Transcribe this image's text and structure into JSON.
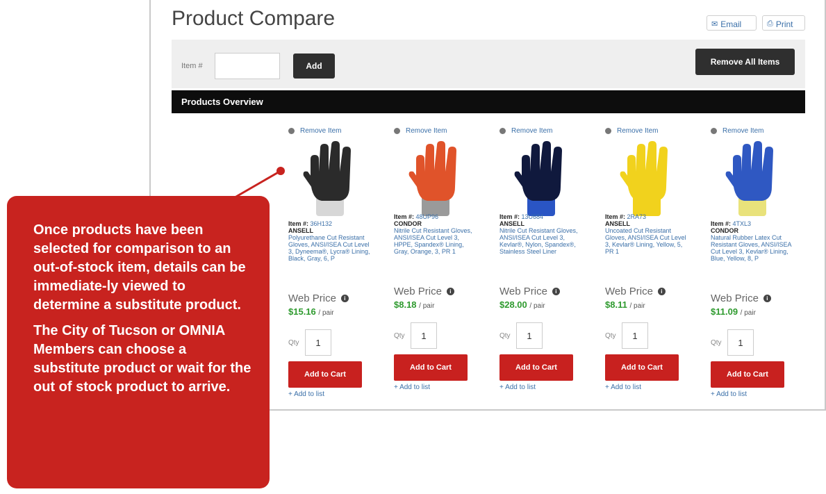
{
  "page": {
    "title": "Product Compare",
    "email_label": "Email",
    "print_label": "Print",
    "item_label": "Item #",
    "item_value": "",
    "add_label": "Add",
    "remove_all_label": "Remove All Items",
    "overview_label": "Products Overview"
  },
  "icons": {
    "email": "envelope-icon",
    "print": "printer-icon",
    "remove": "remove-circle-icon",
    "info": "info-circle-icon"
  },
  "colors": {
    "accent_red": "#c8211f",
    "price_green": "#2e9a2e",
    "link_blue": "#3a6fa8",
    "dark_button": "#2f2f2f"
  },
  "products": [
    {
      "remove_label": "Remove Item",
      "item_prefix": "Item #:",
      "item_no": "36H132",
      "brand": "ANSELL",
      "description": "Polyurethane Cut Resistant Gloves, ANSI/ISEA Cut Level 3, Dyneema®, Lycra® Lining, Black, Gray, 6, P",
      "web_price_label": "Web Price",
      "price": "$15.16",
      "unit": "/ pair",
      "qty_label": "Qty",
      "qty": "1",
      "cart_label": "Add to Cart",
      "list_label": "+ Add to list",
      "glove_color": "#d7d7d7",
      "coat_color": "#2b2b2b"
    },
    {
      "remove_label": "Remove Item",
      "item_prefix": "Item #:",
      "item_no": "48UP96",
      "brand": "CONDOR",
      "description": "Nitrile Cut Resistant Gloves, ANSI/ISEA Cut Level 3, HPPE, Spandex® Lining, Gray, Orange, 3, PR 1",
      "web_price_label": "Web Price",
      "price": "$8.18",
      "unit": "/ pair",
      "qty_label": "Qty",
      "qty": "1",
      "cart_label": "Add to Cart",
      "list_label": "+ Add to list",
      "glove_color": "#9a9a9a",
      "coat_color": "#e0532a"
    },
    {
      "remove_label": "Remove Item",
      "item_prefix": "Item #:",
      "item_no": "13U684",
      "brand": "ANSELL",
      "description": "Nitrile Cut Resistant Gloves, ANSI/ISEA Cut Level 3, Kevlar®, Nylon, Spandex®, Stainless Steel Liner",
      "web_price_label": "Web Price",
      "price": "$28.00",
      "unit": "/ pair",
      "qty_label": "Qty",
      "qty": "1",
      "cart_label": "Add to Cart",
      "list_label": "+ Add to list",
      "glove_color": "#2a55c4",
      "coat_color": "#10193d"
    },
    {
      "remove_label": "Remove Item",
      "item_prefix": "Item #:",
      "item_no": "2RA73",
      "brand": "ANSELL",
      "description": "Uncoated Cut Resistant Gloves, ANSI/ISEA Cut Level 3, Kevlar® Lining, Yellow, 5, PR 1",
      "web_price_label": "Web Price",
      "price": "$8.11",
      "unit": "/ pair",
      "qty_label": "Qty",
      "qty": "1",
      "cart_label": "Add to Cart",
      "list_label": "+ Add to list",
      "glove_color": "#f1d21d",
      "coat_color": "#f1d21d"
    },
    {
      "remove_label": "Remove Item",
      "item_prefix": "Item #:",
      "item_no": "4TXL3",
      "brand": "CONDOR",
      "description": "Natural Rubber Latex Cut Resistant Gloves, ANSI/ISEA Cut Level 3, Kevlar® Lining, Blue, Yellow, 8, P",
      "web_price_label": "Web Price",
      "price": "$11.09",
      "unit": "/ pair",
      "qty_label": "Qty",
      "qty": "1",
      "cart_label": "Add to Cart",
      "list_label": "+ Add to list",
      "glove_color": "#e9e27b",
      "coat_color": "#2f58c2"
    }
  ],
  "callout": {
    "paragraph_1": "Once products have been selected for comparison to an out-of-stock item, details can be immediate-ly viewed to determine a substitute product.",
    "paragraph_2": "The City of Tucson or OMNIA Members can choose a substitute product or wait for the out of stock product to arrive."
  }
}
